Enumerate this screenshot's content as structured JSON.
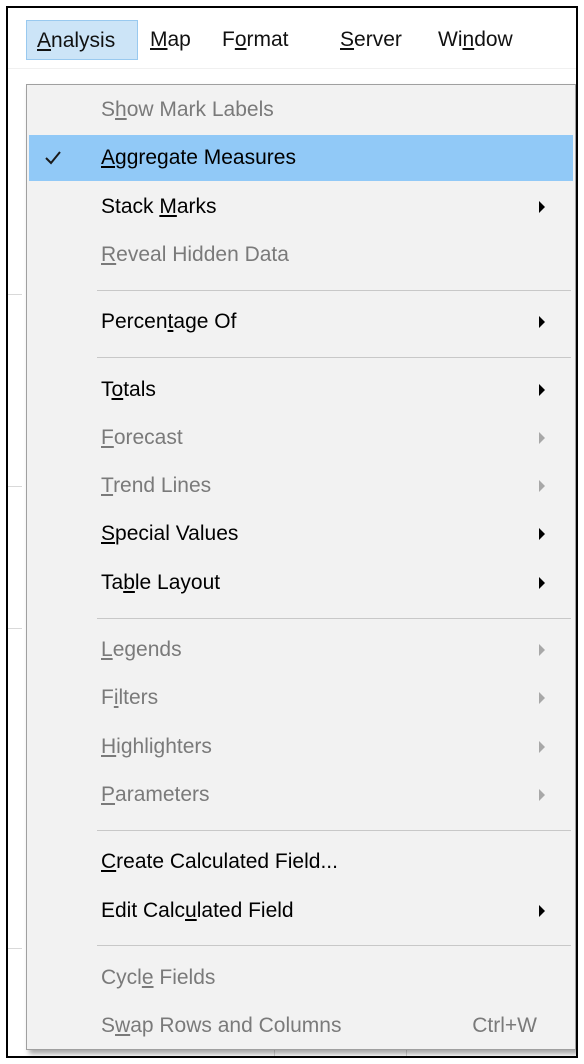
{
  "menubar": {
    "items": [
      {
        "label": "Analysis",
        "mnemonic_index": 0,
        "active": true
      },
      {
        "label": "Map",
        "mnemonic_index": 0,
        "active": false
      },
      {
        "label": "Format",
        "mnemonic_index": 1,
        "active": false
      },
      {
        "label": "Server",
        "mnemonic_index": 0,
        "active": false
      },
      {
        "label": "Window",
        "mnemonic_index": 2,
        "active": false
      }
    ]
  },
  "menu": {
    "items": [
      {
        "label": "Show Mark Labels",
        "mnemonic_index": 1,
        "enabled": false,
        "submenu": false
      },
      {
        "label": "Aggregate Measures",
        "mnemonic_index": 0,
        "enabled": true,
        "submenu": false,
        "checked": true,
        "highlighted": true
      },
      {
        "label": "Stack Marks",
        "mnemonic_index": 6,
        "enabled": true,
        "submenu": true
      },
      {
        "label": "Reveal Hidden Data",
        "mnemonic_index": 0,
        "enabled": false,
        "submenu": false
      },
      {
        "separator": true
      },
      {
        "label": "Percentage Of",
        "mnemonic_index": 6,
        "enabled": true,
        "submenu": true
      },
      {
        "separator": true
      },
      {
        "label": "Totals",
        "mnemonic_index": 1,
        "enabled": true,
        "submenu": true
      },
      {
        "label": "Forecast",
        "mnemonic_index": 0,
        "enabled": false,
        "submenu": true
      },
      {
        "label": "Trend Lines",
        "mnemonic_index": 0,
        "enabled": false,
        "submenu": true
      },
      {
        "label": "Special Values",
        "mnemonic_index": 0,
        "enabled": true,
        "submenu": true
      },
      {
        "label": "Table Layout",
        "mnemonic_index": 2,
        "enabled": true,
        "submenu": true
      },
      {
        "separator": true
      },
      {
        "label": "Legends",
        "mnemonic_index": 0,
        "enabled": false,
        "submenu": true
      },
      {
        "label": "Filters",
        "mnemonic_index": 1,
        "enabled": false,
        "submenu": true
      },
      {
        "label": "Highlighters",
        "mnemonic_index": 0,
        "enabled": false,
        "submenu": true
      },
      {
        "label": "Parameters",
        "mnemonic_index": 0,
        "enabled": false,
        "submenu": true
      },
      {
        "separator": true
      },
      {
        "label": "Create Calculated Field...",
        "mnemonic_index": 0,
        "enabled": true,
        "submenu": false
      },
      {
        "label": "Edit Calculated Field",
        "mnemonic_index": 9,
        "enabled": true,
        "submenu": true
      },
      {
        "separator": true
      },
      {
        "label": "Cycle Fields",
        "mnemonic_index": 4,
        "enabled": false,
        "submenu": false
      },
      {
        "label": "Swap Rows and Columns",
        "mnemonic_index": 1,
        "enabled": false,
        "submenu": false,
        "shortcut": "Ctrl+W"
      }
    ]
  },
  "colors": {
    "highlight": "#91c9f7",
    "menubar_active": "#cce4f7",
    "menu_background": "#f2f2f2",
    "disabled_text": "#7a7a7a"
  }
}
